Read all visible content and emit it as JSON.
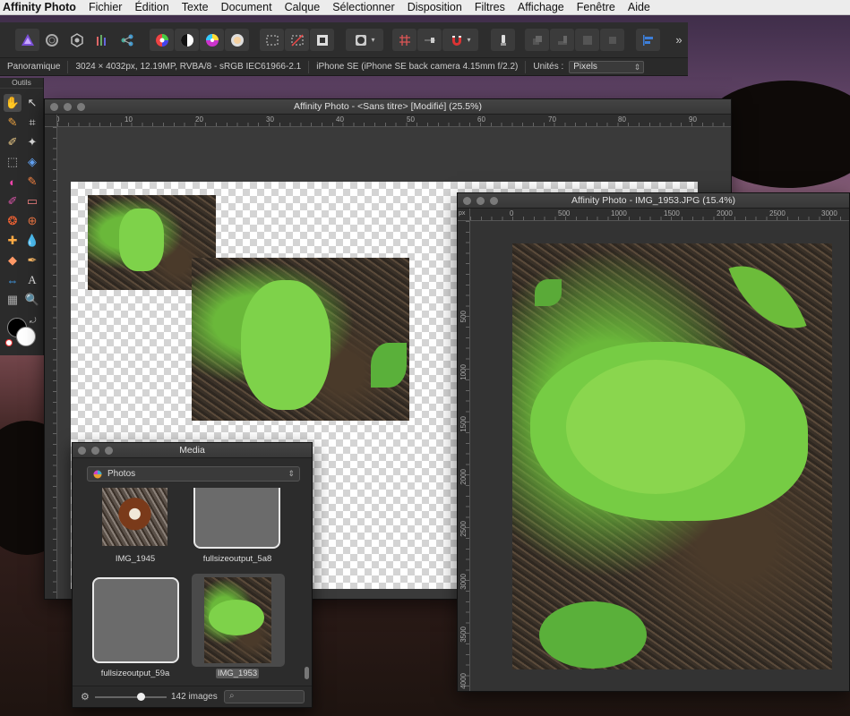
{
  "menubar": {
    "app_name": "Affinity Photo",
    "items": [
      "Fichier",
      "Édition",
      "Texte",
      "Document",
      "Calque",
      "Sélectionner",
      "Disposition",
      "Filtres",
      "Affichage",
      "Fenêtre",
      "Aide"
    ]
  },
  "context": {
    "mode": "Panoramique",
    "doc_info": "3024 × 4032px, 12.19MP, RVBA/8 - sRGB IEC61966-2.1",
    "camera": "iPhone SE (iPhone SE back camera 4.15mm f/2.2)",
    "units_label": "Unités :",
    "units_value": "Pixels"
  },
  "tools_panel": {
    "title": "Outils"
  },
  "main_window": {
    "title": "Affinity Photo - <Sans titre> [Modifié] (25.5%)",
    "ruler_ticks": [
      "0",
      "10",
      "20",
      "30",
      "40",
      "50",
      "60",
      "70",
      "80",
      "90"
    ]
  },
  "photo_window": {
    "title": "Affinity Photo - IMG_1953.JPG (15.4%)",
    "ruler_unit": "px",
    "h_ticks": [
      "0",
      "500",
      "1000",
      "1500",
      "2000",
      "2500",
      "3000"
    ],
    "v_ticks": [
      "500",
      "1000",
      "1500",
      "2000",
      "2500",
      "3000",
      "3500",
      "4000"
    ]
  },
  "media_panel": {
    "title": "Media",
    "source": "Photos",
    "items": [
      {
        "label": "IMG_1945",
        "selected": false
      },
      {
        "label": "fullsizeoutput_5a8",
        "selected": false
      },
      {
        "label": "fullsizeoutput_59a",
        "selected": false
      },
      {
        "label": "IMG_1953",
        "selected": true
      }
    ],
    "count": "142 images"
  },
  "colors": {
    "accent": "#3d7fd9",
    "persona_purple": "#7a4fd6"
  }
}
